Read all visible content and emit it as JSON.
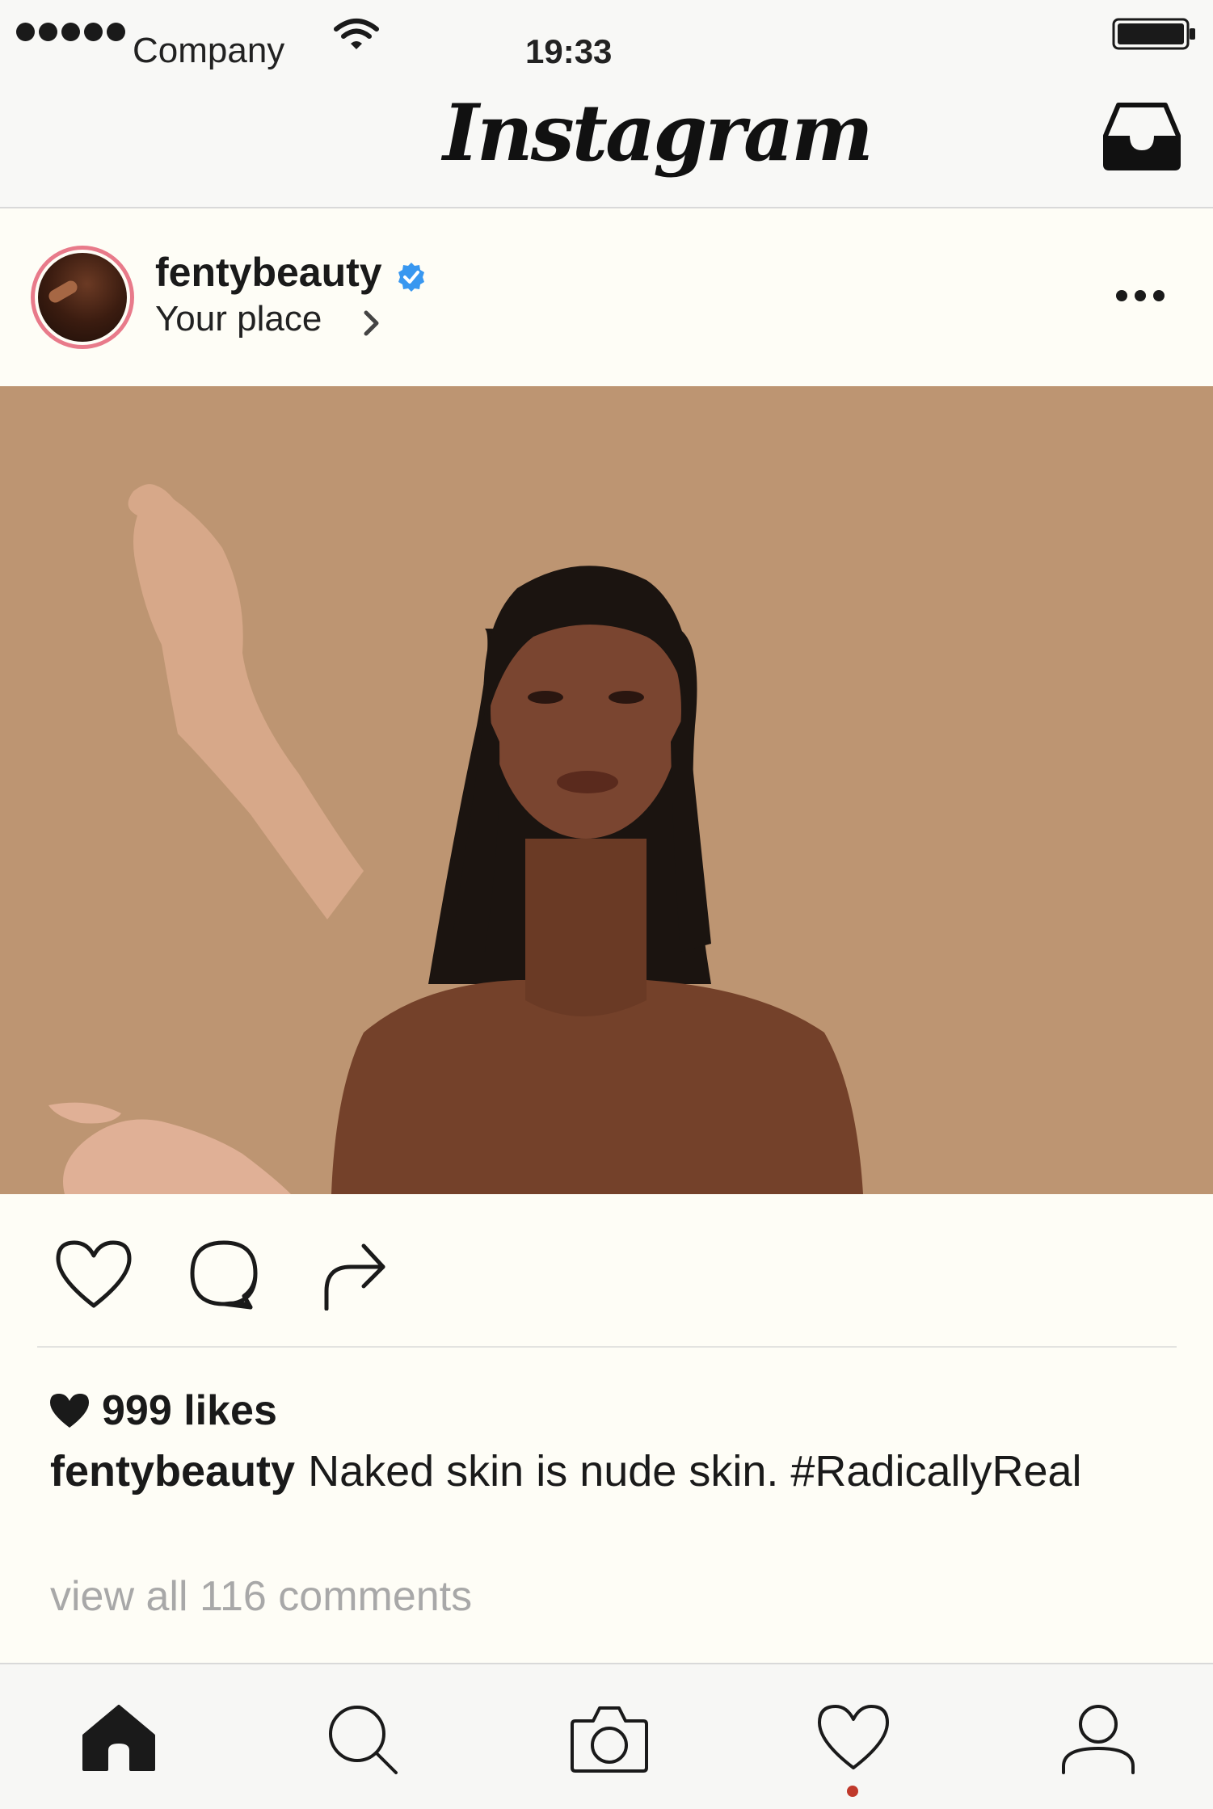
{
  "status_bar": {
    "carrier": "Company",
    "time": "19:33"
  },
  "header": {
    "brand": "Instagram",
    "inbox_icon": "inbox-tray-icon"
  },
  "post": {
    "username": "fentybeauty",
    "verified": true,
    "location": "Your place",
    "more_icon": "more-horizontal-icon",
    "photo_bg_color": "#bd9572",
    "actions": [
      "heart-icon",
      "comment-icon",
      "share-icon"
    ],
    "likes": "999 likes",
    "caption_user": "fentybeauty",
    "caption_text": "Naked skin is nude skin. #RadicallyReal",
    "view_comments": "view all 116 comments"
  },
  "tabbar": {
    "tabs": [
      "home-icon",
      "search-icon",
      "camera-icon",
      "activity-heart-icon",
      "profile-icon"
    ],
    "active": "home",
    "notification_color": "#c0392b"
  },
  "colors": {
    "verified_blue": "#3897f0",
    "avatar_ring": "#e87a8a"
  }
}
